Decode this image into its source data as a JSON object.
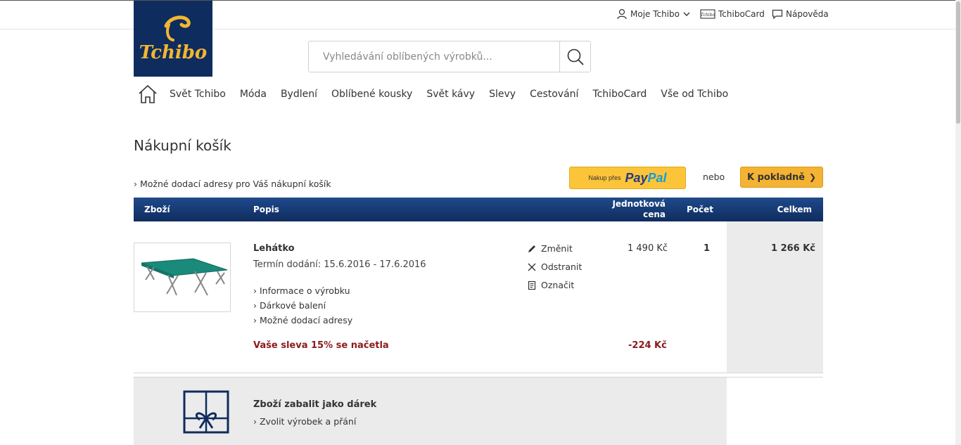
{
  "header": {
    "logo_text": "Tchibo",
    "my_account": "Moje Tchibo",
    "card": "TchiboCard",
    "help": "Nápověda"
  },
  "search": {
    "placeholder": "Vyhledávání oblíbených výrobků..."
  },
  "nav": {
    "items": [
      "Svět Tchibo",
      "Móda",
      "Bydlení",
      "Oblíbené kousky",
      "Svět kávy",
      "Slevy",
      "Cestování",
      "TchiboCard",
      "Vše od Tchibo"
    ]
  },
  "cart": {
    "title": "Nákupní košík",
    "delivery_link": "Možné dodací adresy pro Váš nákupní košík",
    "paypal_prefix": "Nakup přes",
    "paypal_pay": "Pay",
    "paypal_pal": "Pal",
    "or": "nebo",
    "checkout": "K pokladně",
    "columns": {
      "item": "Zboží",
      "description": "Popis",
      "unit_price_1": "Jednotková",
      "unit_price_2": "cena",
      "quantity": "Počet",
      "total": "Celkem"
    },
    "product": {
      "name": "Lehátko",
      "delivery": "Termín dodání: 15.6.2016 - 17.6.2016",
      "links": [
        "Informace o výrobku",
        "Dárkové balení",
        "Možné dodací adresy"
      ],
      "actions": [
        "Změnit",
        "Odstranit",
        "Označit"
      ],
      "unit_price": "1 490 Kč",
      "quantity": "1",
      "total": "1 266 Kč",
      "discount_label": "Vaše sleva 15% se načetla",
      "discount_value": "-224 Kč"
    },
    "gift": {
      "title": "Zboží zabalit jako dárek",
      "link": "Zvolit výrobek a přání"
    }
  },
  "colors": {
    "brand_navy": "#0f2c5e",
    "logo_gold": "#f2b632",
    "checkout_orange": "#f5b333",
    "paypal_yellow": "#fcc439",
    "discount_red": "#8b1a1a"
  }
}
